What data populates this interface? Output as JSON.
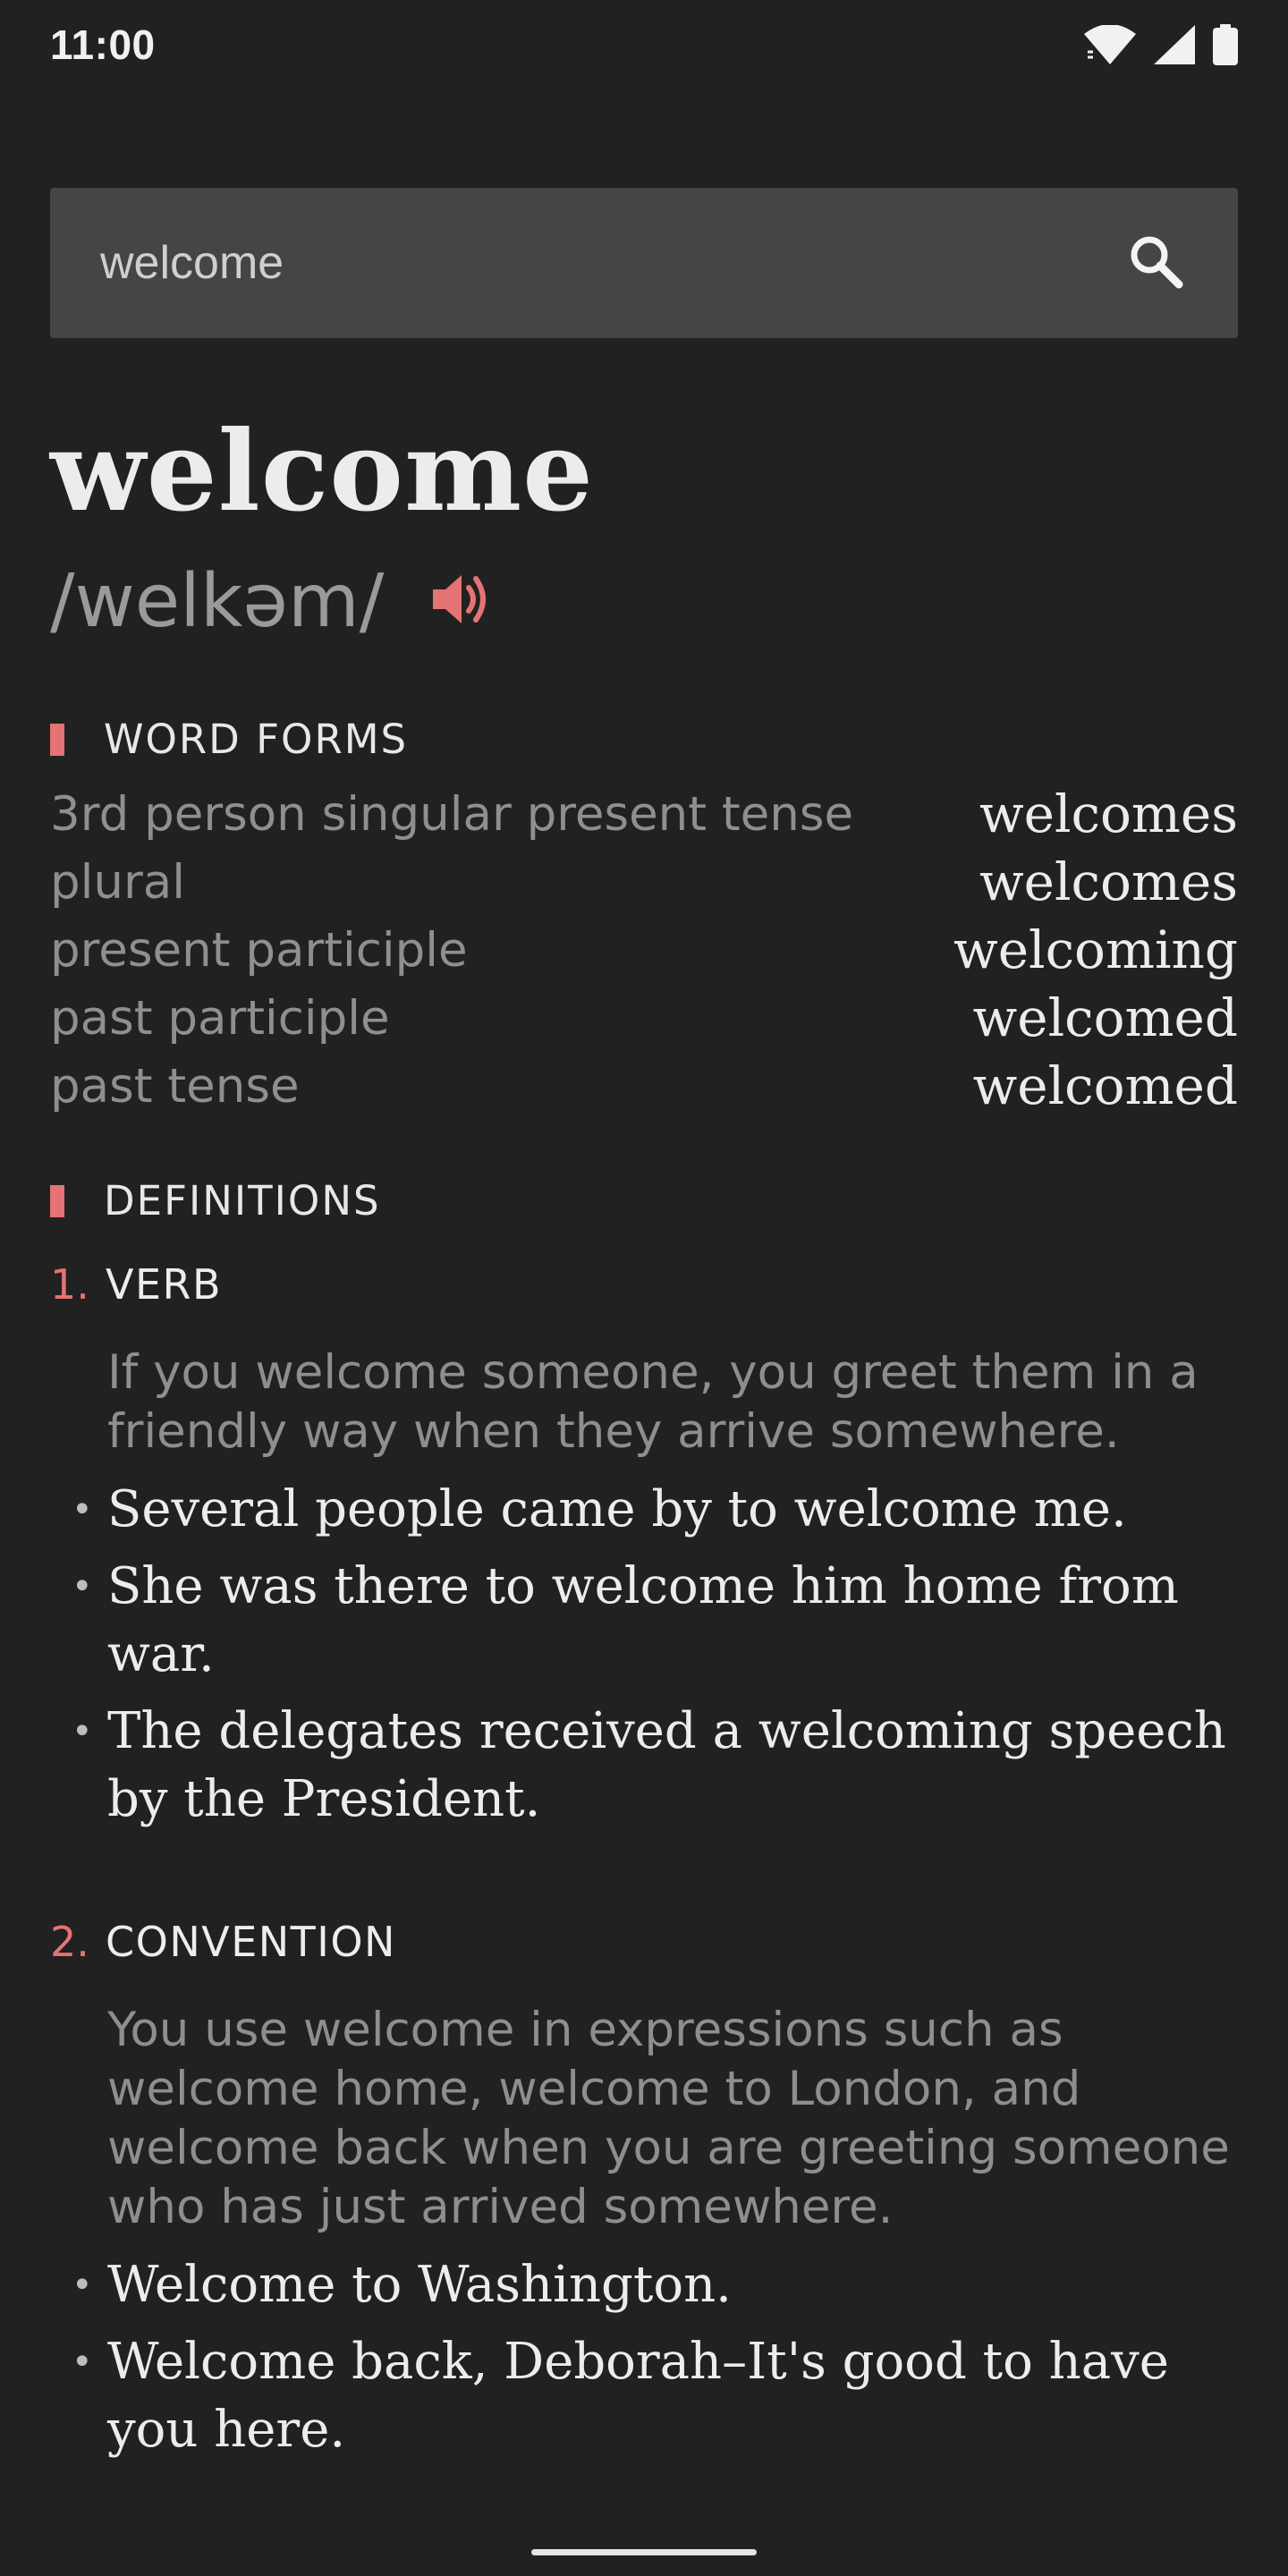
{
  "status_bar": {
    "time": "11:00",
    "icons": [
      "wifi-icon",
      "cell-signal-icon",
      "battery-icon"
    ]
  },
  "search": {
    "value": "welcome",
    "placeholder": "",
    "icon": "search-icon"
  },
  "entry": {
    "headword": "welcome",
    "pronunciation": "/welkəm/",
    "audio_icon": "speaker-icon"
  },
  "word_forms": {
    "title": "WORD FORMS",
    "rows": [
      {
        "label": "3rd person singular present tense",
        "value": "welcomes"
      },
      {
        "label": "plural",
        "value": "welcomes"
      },
      {
        "label": "present participle",
        "value": "welcoming"
      },
      {
        "label": "past participle",
        "value": "welcomed"
      },
      {
        "label": "past tense",
        "value": "welcomed"
      }
    ]
  },
  "definitions": {
    "title": "DEFINITIONS",
    "items": [
      {
        "number": "1.",
        "pos": "VERB",
        "text": "If you welcome someone, you greet them in a friendly way when they arrive somewhere.",
        "examples": [
          "Several people came by to welcome me.",
          "She was there to welcome him home from war.",
          "The delegates received a welcoming speech by the President."
        ]
      },
      {
        "number": "2.",
        "pos": "CONVENTION",
        "text": "You use welcome in expressions such as welcome home, welcome to London, and welcome back when you are greeting someone who has just arrived somewhere.",
        "examples": [
          "Welcome to Washington.",
          "Welcome back, Deborah–It's good to have you here."
        ]
      }
    ]
  },
  "colors": {
    "background": "#212121",
    "search_bg": "#454545",
    "accent": "#e57373",
    "muted_text": "#8e8e8e",
    "primary_text": "#ececec"
  }
}
